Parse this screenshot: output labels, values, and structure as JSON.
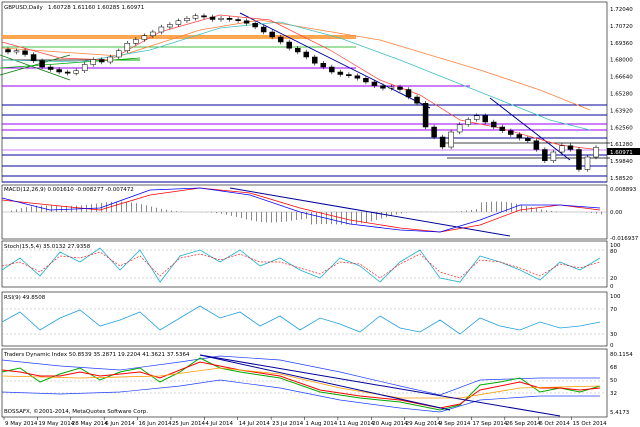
{
  "main_header": {
    "symbol": "GBPUSD,Daily",
    "ohlc": "1.60728 1.61160 1.60285 1.60971"
  },
  "copyright": "BOSSAFX, ©2001-2014, MetaQuotes Software Corp.",
  "panels": [
    {
      "id": "main",
      "title": "",
      "axis_labels": [
        "1.72040",
        "1.70720",
        "1.69360",
        "1.68000",
        "1.66640",
        "1.65280",
        "1.63920",
        "1.62560",
        "1.61280",
        "1.59840",
        "1.58520"
      ],
      "highlight": "1.60971"
    },
    {
      "id": "macd",
      "title": "MACD(12,26,9) 0.001610 -0.008277 -0.007472",
      "axis_labels": [
        "0.008893",
        "0.00",
        "-0.016937"
      ]
    },
    {
      "id": "stoch",
      "title": "Stoch(15,5,4) 35.0132 27.9358",
      "axis_labels": [
        "100",
        "80",
        "20",
        "0"
      ]
    },
    {
      "id": "rsi",
      "title": "RSI(9) 49.8508",
      "axis_labels": [
        "100",
        "70",
        "30",
        "0"
      ]
    },
    {
      "id": "tdi",
      "title": "Traders Dynamic Index 50.8539 35.2871 19.2204 41.3621 37.5364",
      "axis_labels": [
        "80.1154",
        "68",
        "50",
        "32",
        "5.4173"
      ]
    }
  ],
  "dates": [
    "9 May 2014",
    "19 May 2014",
    "28 May 2014",
    "6 Jun 2014",
    "16 Jun 2014",
    "25 Jun 2014",
    "4 Jul 2014",
    "14 Jul 2014",
    "23 Jul 2014",
    "1 Aug 2014",
    "11 Aug 2014",
    "20 Aug 2014",
    "29 Aug 2014",
    "9 Sep 2014",
    "17 Sep 2014",
    "26 Sep 2014",
    "6 Oct 2014",
    "15 Oct 2014"
  ],
  "chart_data": {
    "type": "candlestick",
    "closes": [
      1.686,
      1.687,
      1.684,
      1.679,
      1.674,
      1.672,
      1.67,
      1.669,
      1.671,
      1.676,
      1.68,
      1.678,
      1.682,
      1.687,
      1.693,
      1.696,
      1.699,
      1.702,
      1.706,
      1.708,
      1.711,
      1.713,
      1.715,
      1.714,
      1.712,
      1.713,
      1.712,
      1.711,
      1.709,
      1.706,
      1.702,
      1.698,
      1.694,
      1.689,
      1.686,
      1.682,
      1.677,
      1.674,
      1.67,
      1.668,
      1.667,
      1.665,
      1.662,
      1.659,
      1.657,
      1.658,
      1.656,
      1.65,
      1.645,
      1.626,
      1.618,
      1.61,
      1.622,
      1.628,
      1.632,
      1.635,
      1.63,
      1.626,
      1.623,
      1.62,
      1.617,
      1.615,
      1.608,
      1.599,
      1.606,
      1.611,
      1.608,
      1.592,
      1.602,
      1.6097
    ]
  }
}
